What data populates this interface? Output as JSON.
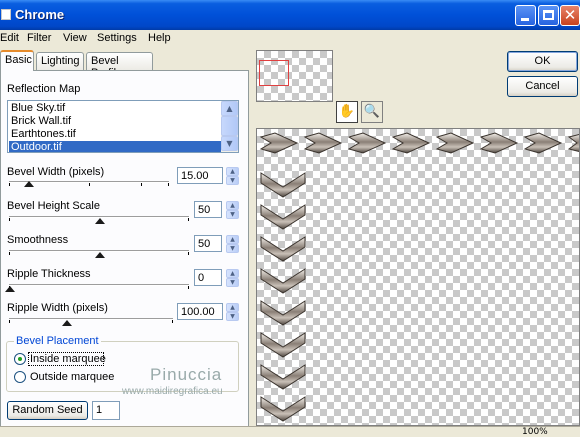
{
  "window": {
    "title": "Chrome"
  },
  "menu": [
    "Edit",
    "Filter",
    "View",
    "Settings",
    "Help"
  ],
  "tabs": [
    "Basic",
    "Lighting",
    "Bevel Profile"
  ],
  "reflection_map": {
    "label": "Reflection Map",
    "items": [
      "Blue Sky.tif",
      "Brick Wall.tif",
      "Earthtones.tif",
      "Outdoor.tif"
    ],
    "selected_index": 3
  },
  "controls": {
    "bevel_width": {
      "label": "Bevel Width (pixels)",
      "value": "15.00",
      "level": 0.12
    },
    "bevel_height": {
      "label": "Bevel Height Scale",
      "value": "50",
      "level": 0.5
    },
    "smoothness": {
      "label": "Smoothness",
      "value": "50",
      "level": 0.5
    },
    "ripple_thickness": {
      "label": "Ripple Thickness",
      "value": "0",
      "level": 0.0
    },
    "ripple_width": {
      "label": "Ripple Width (pixels)",
      "value": "100.00",
      "level": 0.35
    }
  },
  "bevel_placement": {
    "title": "Bevel Placement",
    "options": [
      "Inside marquee",
      "Outside marquee"
    ],
    "selected": "Inside marquee"
  },
  "random_seed": {
    "label": "Random Seed",
    "value": "1"
  },
  "buttons": {
    "ok": "OK",
    "cancel": "Cancel"
  },
  "watermark": {
    "name": "Pinuccia",
    "url": "www.maidiregrafica.eu"
  },
  "status": {
    "zoom": "100%"
  },
  "tools": [
    "hand-icon",
    "zoom-icon"
  ],
  "colors": {
    "titlebar": "#0050d8",
    "selection": "#316ac5",
    "tab_accent": "#e68b2c",
    "group_title": "#0046d5"
  }
}
